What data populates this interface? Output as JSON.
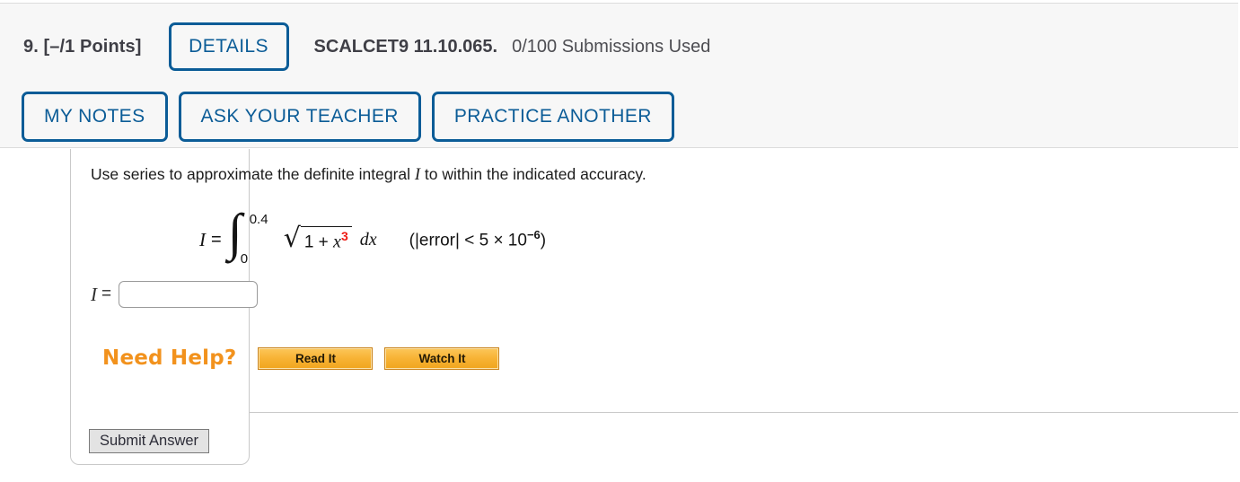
{
  "header": {
    "points": "9.  [–/1 Points]",
    "details_label": "DETAILS",
    "question_code": "SCALCET9 11.10.065.",
    "submissions": "0/100 Submissions Used",
    "buttons": [
      {
        "label": "MY NOTES"
      },
      {
        "label": "ASK YOUR TEACHER"
      },
      {
        "label": "PRACTICE ANOTHER"
      }
    ]
  },
  "question": {
    "prompt_before": "Use series to approximate the definite integral ",
    "prompt_var": "I",
    "prompt_after": " to within the indicated accuracy.",
    "math": {
      "lhs_var": "I",
      "equals": "=",
      "integral_upper": "0.4",
      "integral_lower": "0",
      "radicand_base": "1 + ",
      "radicand_var": "x",
      "radicand_exponent": "3",
      "differential": "dx",
      "error_open": "(|error| < 5 × 10",
      "error_exponent": "−6",
      "error_close": ")"
    }
  },
  "answer": {
    "label_var": "I",
    "equals": "=",
    "value": "",
    "placeholder": ""
  },
  "help": {
    "title": "Need Help?",
    "read_label": "Read It",
    "watch_label": "Watch It"
  },
  "footer": {
    "submit_label": "Submit Answer"
  },
  "colors": {
    "accent_blue": "#0b5c97",
    "header_bg": "#f7f7f7",
    "need_help_orange": "#f2921d",
    "exponent_red": "#ee1b14",
    "border_gray": "#c9c9c9"
  }
}
